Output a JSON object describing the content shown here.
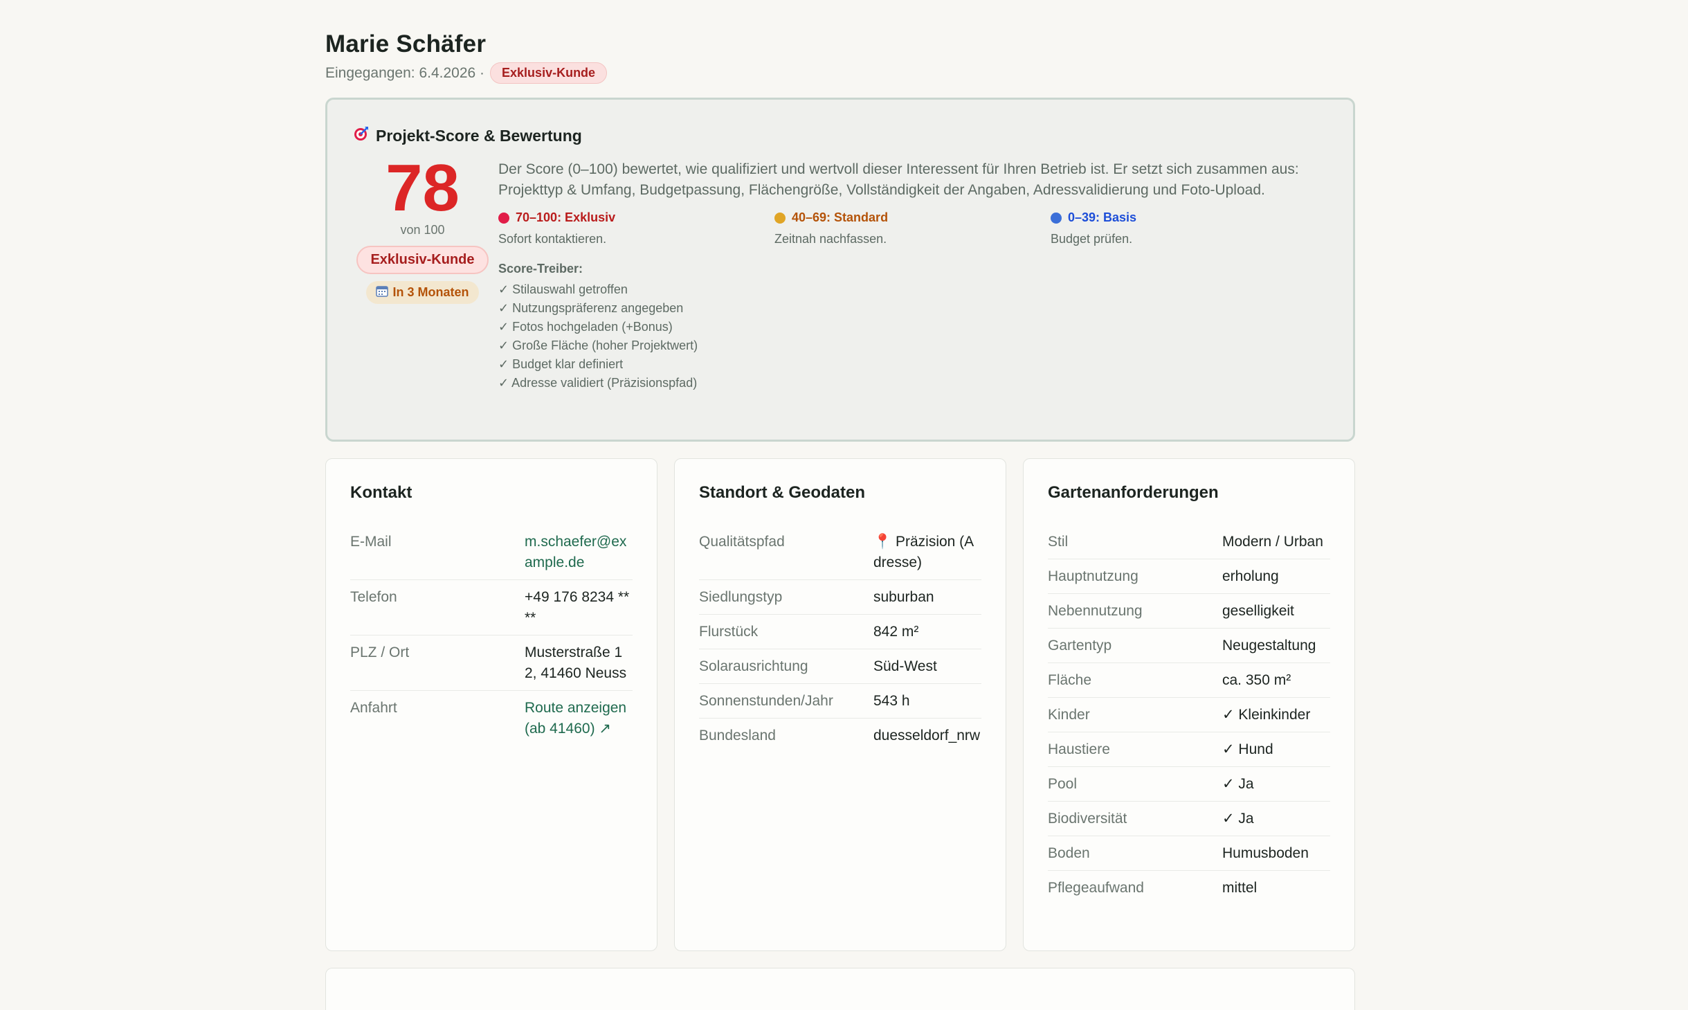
{
  "header": {
    "name": "Marie Schäfer",
    "received": "Eingegangen: 6.4.2026 ·",
    "badge": "Exklusiv-Kunde"
  },
  "score": {
    "title": "Projekt-Score & Bewertung",
    "title_icon": "target-icon",
    "value": "78",
    "of": "von 100",
    "badge": "Exklusiv-Kunde",
    "timeline": "In 3 Monaten",
    "timeline_icon": "calendar-icon",
    "description": "Der Score (0–100) bewertet, wie qualifiziert und wertvoll dieser Interessent für Ihren Betrieb ist. Er setzt sich zusammen aus: Projekttyp & Umfang, Budgetpassung, Flächengröße, Vollständigkeit der Angaben, Adressvalidierung und Foto-Upload.",
    "tiers": [
      {
        "label": "70–100: Exklusiv",
        "text": "Sofort kontaktieren.",
        "color": "#b91c1c",
        "dot": "#e11d48"
      },
      {
        "label": "40–69: Standard",
        "text": "Zeitnah nachfassen.",
        "color": "#b45309",
        "dot": "#e0a526"
      },
      {
        "label": "0–39: Basis",
        "text": "Budget prüfen.",
        "color": "#1d4ed8",
        "dot": "#3b6fd8"
      }
    ],
    "drivers_title": "Score-Treiber:",
    "drivers": [
      "✓ Stilauswahl getroffen",
      "✓ Nutzungspräferenz angegeben",
      "✓ Fotos hochgeladen (+Bonus)",
      "✓ Große Fläche (hoher Projektwert)",
      "✓ Budget klar definiert",
      "✓ Adresse validiert (Präzisionspfad)"
    ]
  },
  "contact": {
    "title": "Kontakt",
    "rows": [
      {
        "label": "E-Mail",
        "value": "m.schaefer@example.de"
      },
      {
        "label": "Telefon",
        "value": "+49 176 8234 ****"
      },
      {
        "label": "PLZ / Ort",
        "value": "Musterstraße 12, 41460 Neuss"
      },
      {
        "label": "Anfahrt",
        "value": "Route anzeigen (ab 41460) ↗"
      }
    ]
  },
  "location": {
    "title": "Standort & Geodaten",
    "rows": [
      {
        "label": "Qualitätspfad",
        "value": "📍 Präzision (Adresse)"
      },
      {
        "label": "Siedlungstyp",
        "value": "suburban"
      },
      {
        "label": "Flurstück",
        "value": "842 m²"
      },
      {
        "label": "Solarausrichtung",
        "value": "Süd-West"
      },
      {
        "label": "Sonnenstunden/Jahr",
        "value": "543 h"
      },
      {
        "label": "Bundesland",
        "value": "duesseldorf_nrw"
      }
    ]
  },
  "garden": {
    "title": "Gartenanforderungen",
    "rows": [
      {
        "label": "Stil",
        "value": "Modern / Urban"
      },
      {
        "label": "Hauptnutzung",
        "value": "erholung"
      },
      {
        "label": "Nebennutzung",
        "value": "geselligkeit"
      },
      {
        "label": "Gartentyp",
        "value": "Neugestaltung"
      },
      {
        "label": "Fläche",
        "value": "ca. 350 m²"
      },
      {
        "label": "Kinder",
        "value": "✓ Kleinkinder"
      },
      {
        "label": "Haustiere",
        "value": "✓ Hund"
      },
      {
        "label": "Pool",
        "value": "✓ Ja"
      },
      {
        "label": "Biodiversität",
        "value": "✓ Ja"
      },
      {
        "label": "Boden",
        "value": "Humusboden"
      },
      {
        "label": "Pflegeaufwand",
        "value": "mittel"
      }
    ]
  }
}
